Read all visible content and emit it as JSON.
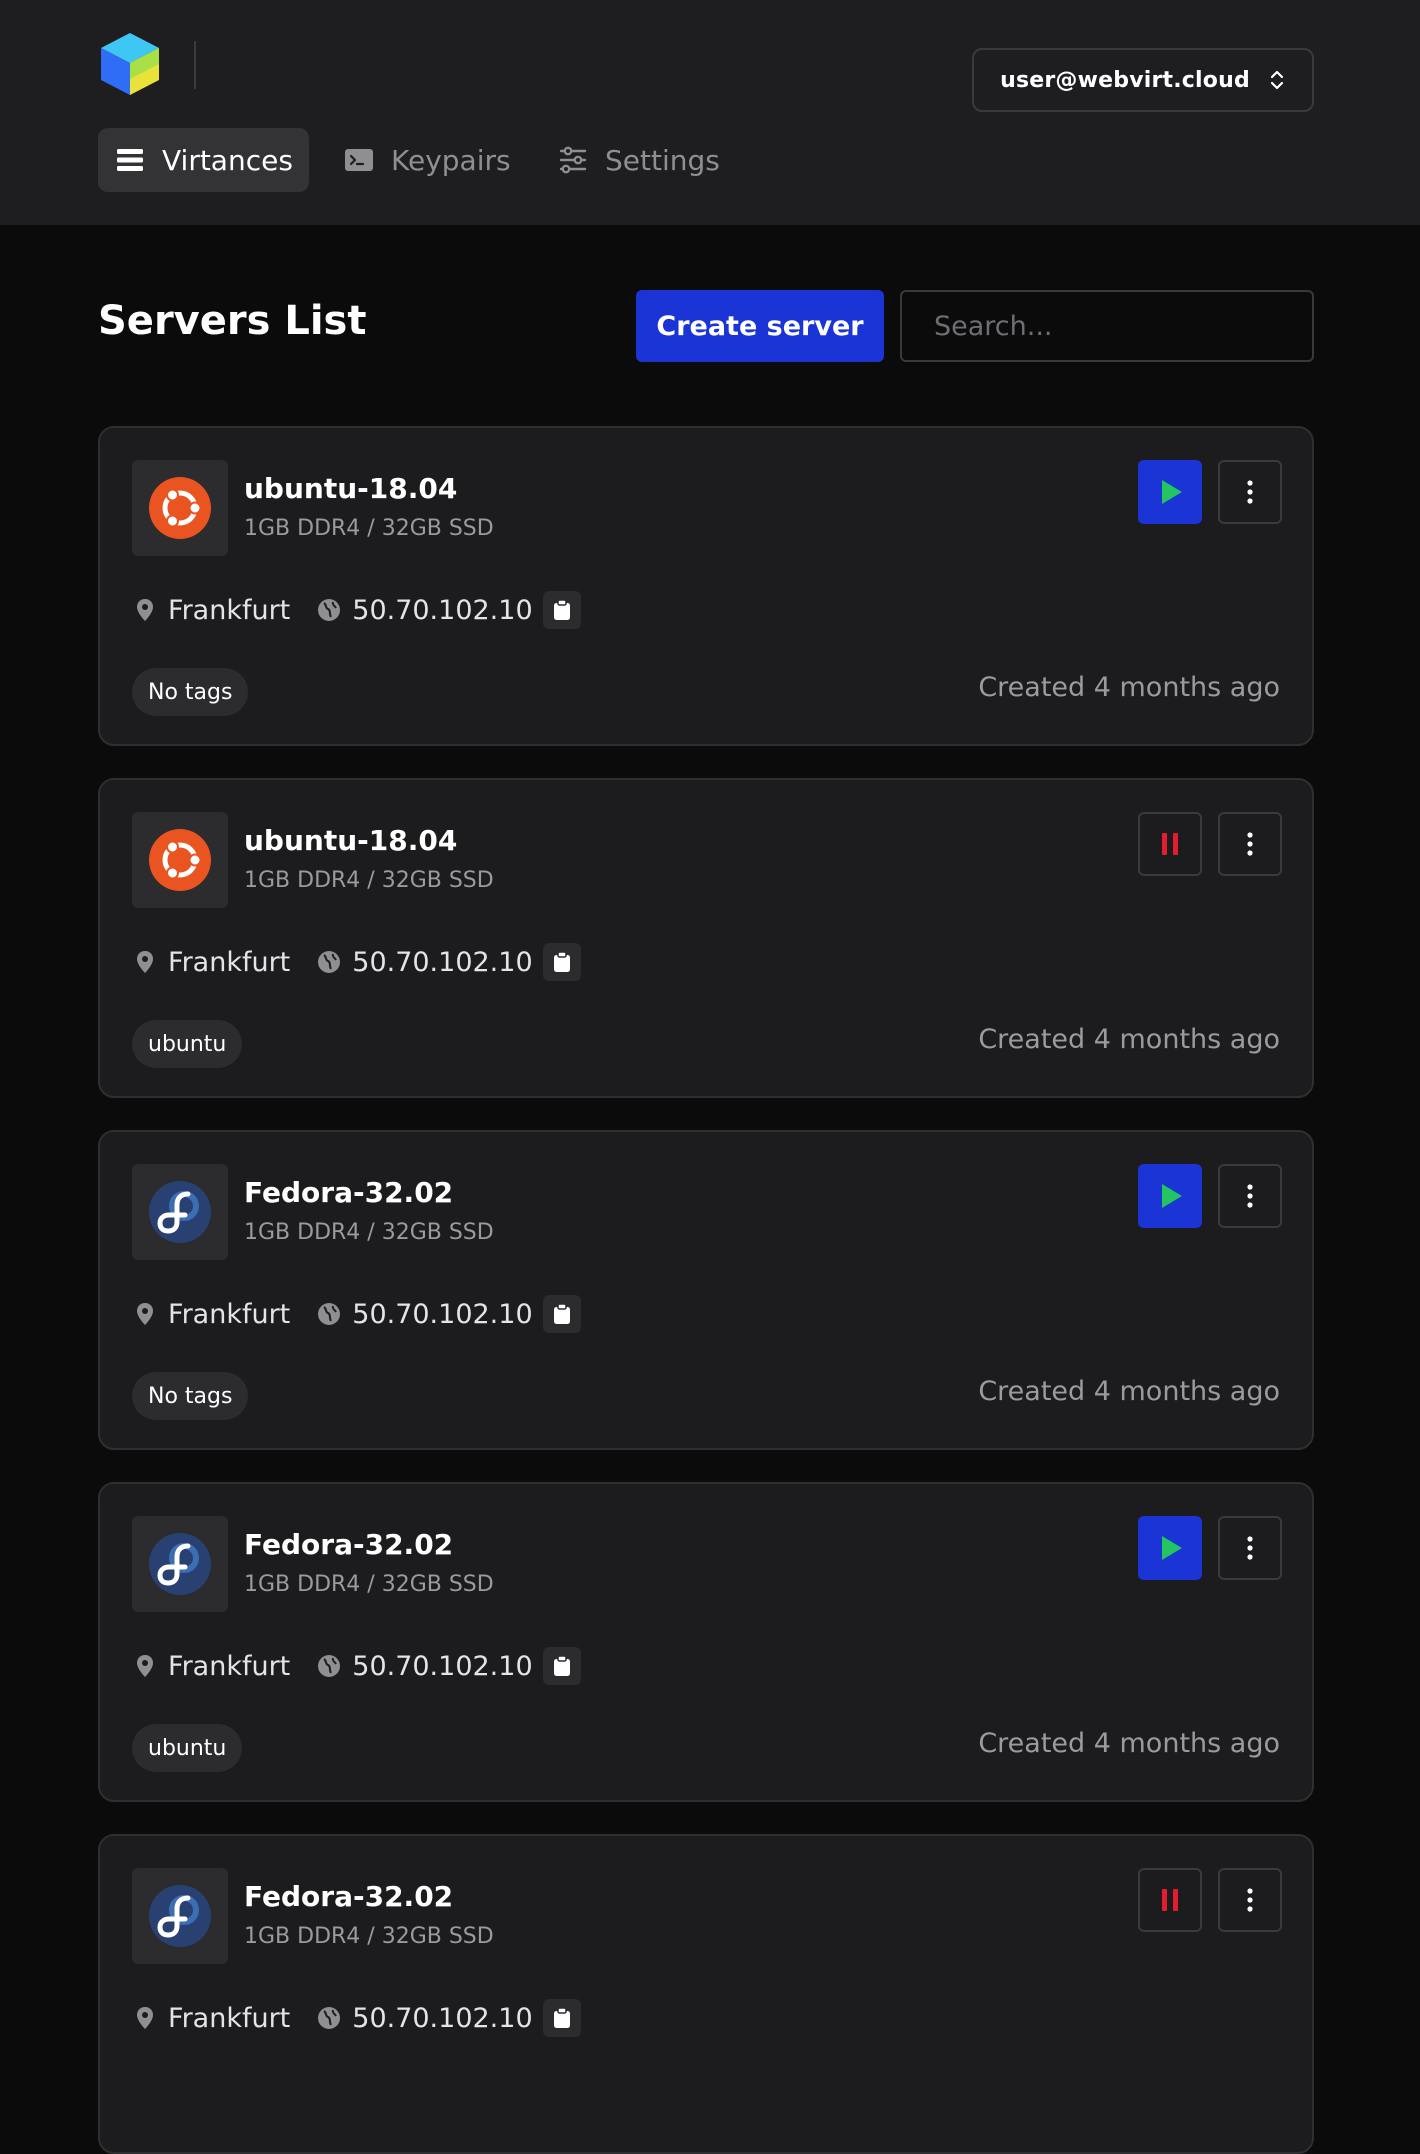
{
  "header": {
    "logo": "webvirt-cube-logo",
    "user": {
      "label": "user@webvirt.cloud",
      "icon": "chevron-up-down-icon"
    }
  },
  "nav": {
    "tabs": [
      {
        "label": "Virtances",
        "icon": "list-icon",
        "active": true
      },
      {
        "label": "Keypairs",
        "icon": "terminal-icon",
        "active": false
      },
      {
        "label": "Settings",
        "icon": "sliders-icon",
        "active": false
      }
    ]
  },
  "main": {
    "title": "Servers List",
    "create_label": "Create server",
    "search_placeholder": "Search..."
  },
  "servers": [
    {
      "name": "ubuntu-18.04",
      "os": "ubuntu",
      "spec": "1GB DDR4 / 32GB SSD",
      "location": "Frankfurt",
      "ip": "50.70.102.10",
      "tag": "No tags",
      "created": "Created 4 months ago",
      "state": "stopped"
    },
    {
      "name": "ubuntu-18.04",
      "os": "ubuntu",
      "spec": "1GB DDR4 / 32GB SSD",
      "location": "Frankfurt",
      "ip": "50.70.102.10",
      "tag": "ubuntu",
      "created": "Created 4 months ago",
      "state": "running"
    },
    {
      "name": "Fedora-32.02",
      "os": "fedora",
      "spec": "1GB DDR4 / 32GB SSD",
      "location": "Frankfurt",
      "ip": "50.70.102.10",
      "tag": "No tags",
      "created": "Created 4 months ago",
      "state": "stopped"
    },
    {
      "name": "Fedora-32.02",
      "os": "fedora",
      "spec": "1GB DDR4 / 32GB SSD",
      "location": "Frankfurt",
      "ip": "50.70.102.10",
      "tag": "ubuntu",
      "created": "Created 4 months ago",
      "state": "stopped"
    },
    {
      "name": "Fedora-32.02",
      "os": "fedora",
      "spec": "1GB DDR4 / 32GB SSD",
      "location": "Frankfurt",
      "ip": "50.70.102.10",
      "tag": "",
      "created": "",
      "state": "running"
    }
  ],
  "colors": {
    "accent": "#1a34d6",
    "play": "#22c55e",
    "pause": "#e11d2e",
    "ubuntu": "#e95420",
    "fedora": "#294172"
  }
}
